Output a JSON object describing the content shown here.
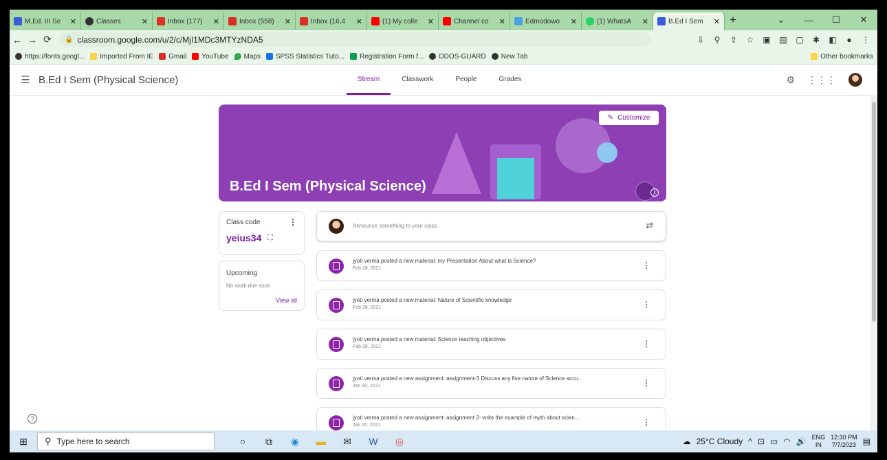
{
  "browser": {
    "tabs": [
      {
        "title": "M.Ed. III Se",
        "color": "#3b5bdb"
      },
      {
        "title": "Classes",
        "color": "#333333"
      },
      {
        "title": "Inbox (177)",
        "color": "#d93025"
      },
      {
        "title": "Inbox (558)",
        "color": "#d93025"
      },
      {
        "title": "Inbox (16,4",
        "color": "#d93025"
      },
      {
        "title": "(1) My colle",
        "color": "#ff0000"
      },
      {
        "title": "Channel co",
        "color": "#ff0000"
      },
      {
        "title": "Edmodowo",
        "color": "#4aa3df"
      },
      {
        "title": "(1) WhatsA",
        "color": "#25d366"
      },
      {
        "title": "B.Ed I Sem",
        "color": "#3b5bdb"
      }
    ],
    "url": "classroom.google.com/u/2/c/MjI1MDc3MTYzNDA5",
    "bookmarks": [
      {
        "label": "https://fonts.googl...",
        "color": "#333333"
      },
      {
        "label": "Imported From IE",
        "color": "#f9d34a"
      },
      {
        "label": "Gmail",
        "color": "#d93025"
      },
      {
        "label": "YouTube",
        "color": "#ff0000"
      },
      {
        "label": "Maps",
        "color": "#34a853"
      },
      {
        "label": "SPSS Statistics Tuto...",
        "color": "#1a73e8"
      },
      {
        "label": "Registration Form f...",
        "color": "#0f9d58"
      },
      {
        "label": "DDOS-GUARD",
        "color": "#333333"
      },
      {
        "label": "New Tab",
        "color": "#333333"
      }
    ],
    "other_bookmarks": "Other bookmarks"
  },
  "classroom": {
    "class_name": "B.Ed I Sem (Physical Science)",
    "nav_tabs": [
      "Stream",
      "Classwork",
      "People",
      "Grades"
    ],
    "banner_title": "B.Ed I Sem (Physical Science)",
    "customize_label": "Customize",
    "class_code_label": "Class code",
    "class_code": "yeius34",
    "upcoming_title": "Upcoming",
    "upcoming_empty": "No work due soon",
    "view_all": "View all",
    "announce_placeholder": "Announce something to your class",
    "posts": [
      {
        "title": "jyoti verma posted a new material: my Presentation About what is Science?",
        "date": "Feb 28, 2021"
      },
      {
        "title": "jyoti verma posted a new material: Nature of Scientific knowledge",
        "date": "Feb 28, 2021"
      },
      {
        "title": "jyoti verma posted a new material: Science teaching objectives",
        "date": "Feb 28, 2021"
      },
      {
        "title": "jyoti verma posted a new assignment: assignment-3 Discuss any five nature of Science acco...",
        "date": "Jan 30, 2021"
      },
      {
        "title": "jyoti verma posted a new assignment: assignment 2- write the example of myth about scien...",
        "date": "Jan 20, 2021"
      }
    ]
  },
  "taskbar": {
    "search_placeholder": "Type here to search",
    "weather": "25°C Cloudy",
    "lang": "ENG",
    "region": "IN",
    "time": "12:30 PM",
    "date": "7/7/2023"
  }
}
